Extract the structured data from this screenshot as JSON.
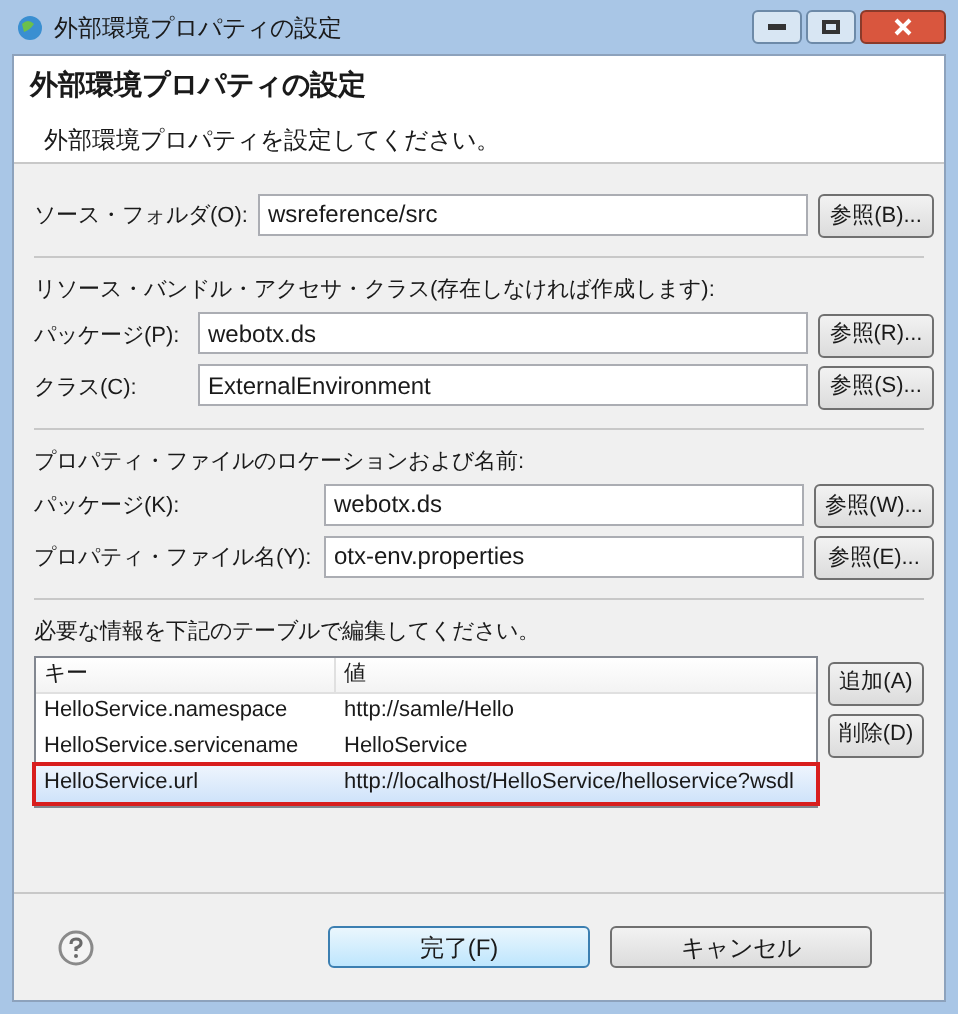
{
  "window": {
    "title": "外部環境プロパティの設定"
  },
  "header": {
    "title": "外部環境プロパティの設定",
    "description": "外部環境プロパティを設定してください。"
  },
  "source_folder": {
    "label": "ソース・フォルダ(O):",
    "value": "wsreference/src",
    "button": "参照(B)..."
  },
  "bundle_section": {
    "heading": "リソース・バンドル・アクセサ・クラス(存在しなければ作成します):",
    "fields": [
      {
        "label": "パッケージ(P):",
        "value": "webotx.ds",
        "button": "参照(R)..."
      },
      {
        "label": "クラス(C):",
        "value": "ExternalEnvironment",
        "button": "参照(S)..."
      }
    ]
  },
  "property_section": {
    "heading": "プロパティ・ファイルのロケーションおよび名前:",
    "fields": [
      {
        "label": "パッケージ(K):",
        "value": "webotx.ds",
        "button": "参照(W)..."
      },
      {
        "label": "プロパティ・ファイル名(Y):",
        "value": "otx-env.properties",
        "button": "参照(E)..."
      }
    ]
  },
  "table_section": {
    "heading": "必要な情報を下記のテーブルで編集してください。",
    "columns": [
      "キー",
      "値"
    ],
    "rows": [
      {
        "cells": [
          "HelloService.namespace",
          "http://samle/Hello"
        ],
        "selected": false
      },
      {
        "cells": [
          "HelloService.servicename",
          "HelloService"
        ],
        "selected": false
      },
      {
        "cells": [
          "HelloService.url",
          "http://localhost/HelloService/helloservice?wsdl"
        ],
        "selected": true
      }
    ],
    "buttons": [
      "追加(A)",
      "削除(D)"
    ]
  },
  "footer": {
    "buttons": [
      {
        "label": "完了(F)",
        "default": true
      },
      {
        "label": "キャンセル",
        "default": false
      }
    ]
  }
}
